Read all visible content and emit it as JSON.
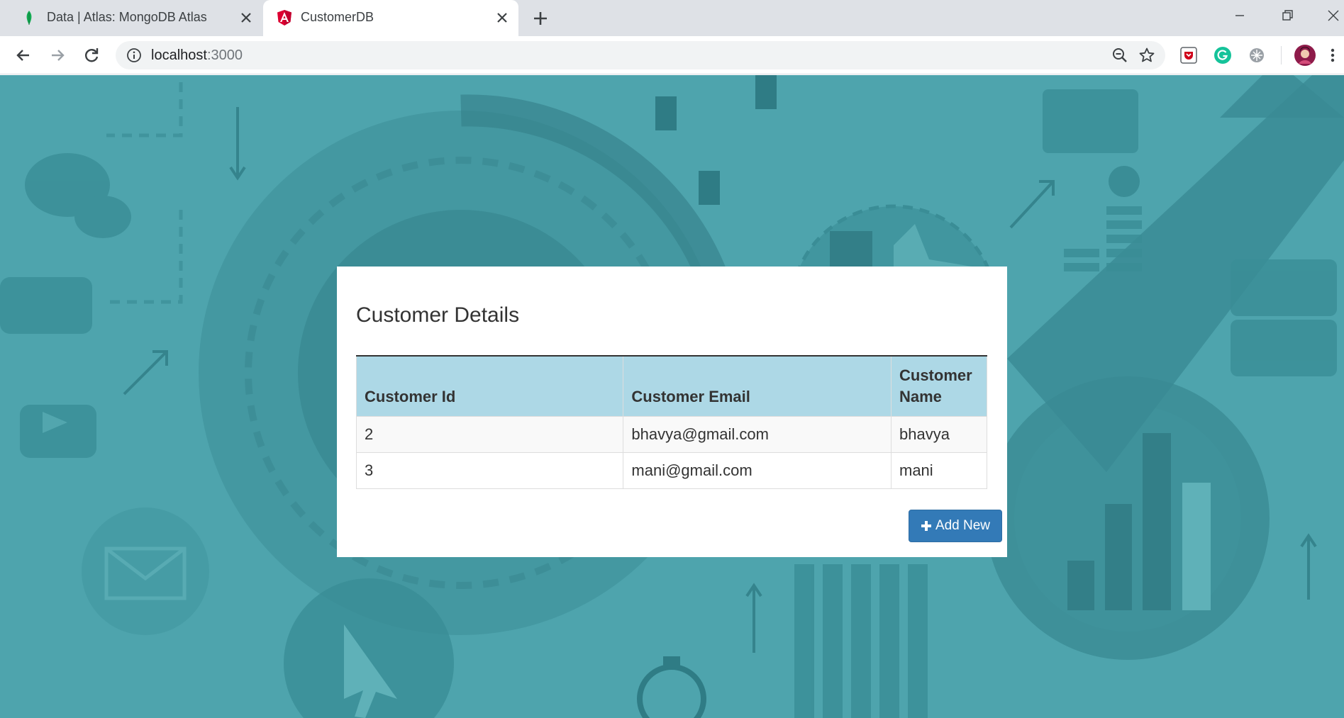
{
  "browser": {
    "tabs": [
      {
        "title": "Data | Atlas: MongoDB Atlas",
        "icon": "mongodb-leaf-icon",
        "active": false
      },
      {
        "title": "CustomerDB",
        "icon": "angular-icon",
        "active": true
      }
    ],
    "url_host": "localhost",
    "url_port": ":3000"
  },
  "page": {
    "heading": "Customer Details",
    "table": {
      "headers": [
        "Customer Id",
        "Customer Email",
        "Customer Name"
      ],
      "rows": [
        [
          "2",
          "bhavya@gmail.com",
          "bhavya"
        ],
        [
          "3",
          "mani@gmail.com",
          "mani"
        ]
      ]
    },
    "add_button_label": "Add New"
  },
  "colors": {
    "background_teal": "#4ea4ad",
    "table_header": "#add8e6",
    "button_primary": "#337ab7"
  }
}
